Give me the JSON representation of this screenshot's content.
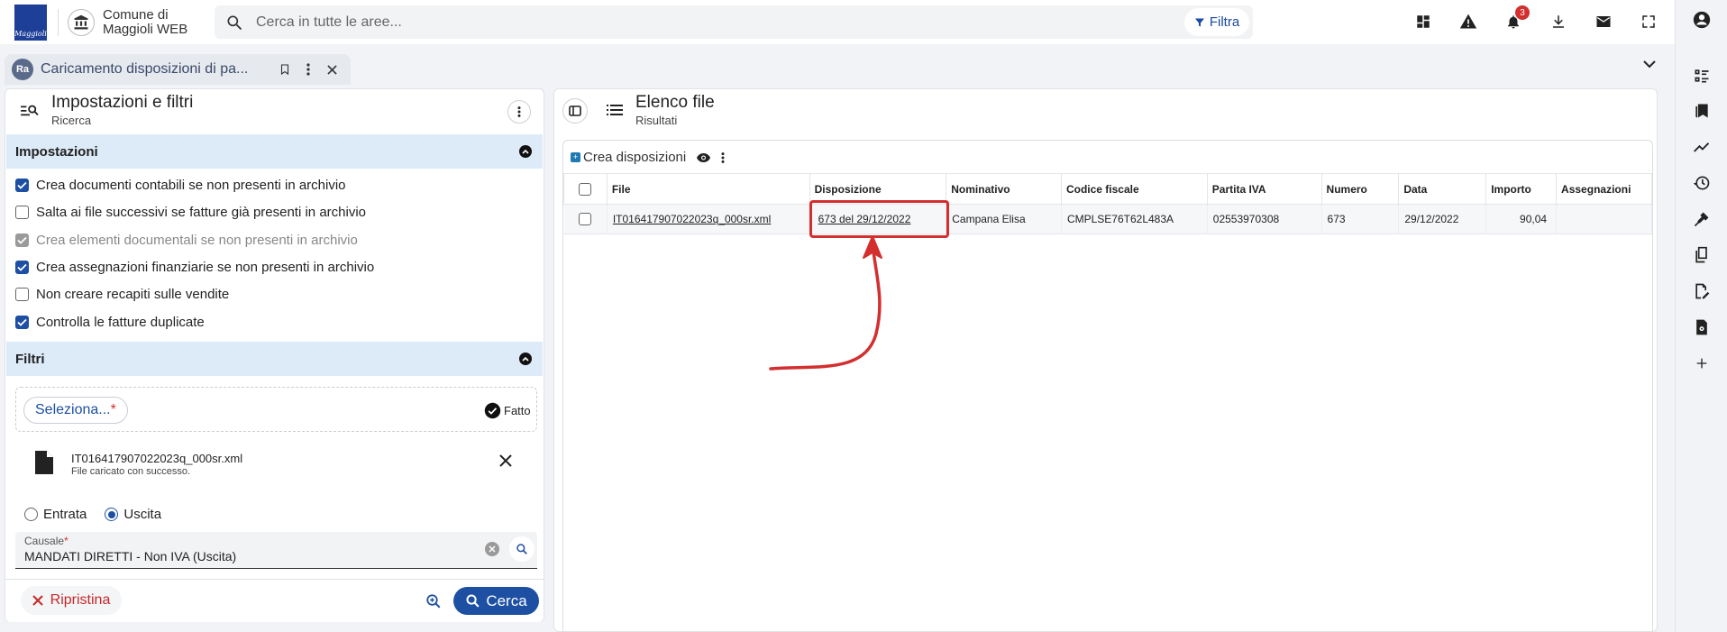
{
  "app": {
    "logo_text": "Maggioli",
    "title": "Comune di Maggioli WEB"
  },
  "search": {
    "placeholder": "Cerca in tutte le aree...",
    "filter_label": "Filtra"
  },
  "topbar_icons": [
    "grid-apps-icon",
    "warning-icon",
    "bell-icon",
    "download-icon",
    "mail-icon",
    "fullscreen-icon",
    "account-icon"
  ],
  "notifications_count": "3",
  "tab": {
    "badge": "Ra",
    "label": "Caricamento disposizioni di pa..."
  },
  "left": {
    "title": "Impostazioni e filtri",
    "subtitle": "Ricerca",
    "settings_header": "Impostazioni",
    "options": [
      {
        "label": "Crea documenti contabili se non presenti in archivio",
        "checked": true
      },
      {
        "label": "Salta ai file successivi se fatture già presenti in archivio",
        "checked": false
      },
      {
        "label": "Crea elementi documentali se non presenti in archivio",
        "checked": true,
        "disabled": true
      },
      {
        "label": "Crea assegnazioni finanziarie se non presenti in archivio",
        "checked": true
      },
      {
        "label": "Non creare recapiti sulle vendite",
        "checked": false
      },
      {
        "label": "Controlla le fatture duplicate",
        "checked": true
      }
    ],
    "filters_header": "Filtri",
    "select_label": "Seleziona...",
    "required_mark": "*",
    "done_label": "Fatto",
    "file": {
      "name": "IT016417907022023q_000sr.xml",
      "status": "File caricato con successo."
    },
    "radio": {
      "entrata": "Entrata",
      "uscita": "Uscita",
      "selected": "Uscita"
    },
    "causale": {
      "label": "Causale",
      "value": "MANDATI DIRETTI - Non IVA (Uscita)"
    },
    "reset_label": "Ripristina",
    "search_label": "Cerca"
  },
  "right": {
    "title": "Elenco file",
    "subtitle": "Risultati",
    "toolbar_label": "Crea disposizioni",
    "columns": [
      "File",
      "Disposizione",
      "Nominativo",
      "Codice fiscale",
      "Partita IVA",
      "Numero",
      "Data",
      "Importo",
      "Assegnazioni"
    ],
    "rows": [
      {
        "file": "IT016417907022023q_000sr.xml",
        "disposizione": "673 del 29/12/2022",
        "nominativo": "Campana Elisa",
        "codice_fiscale": "CMPLSE76T62L483A",
        "partita_iva": "02553970308",
        "numero": "673",
        "data": "29/12/2022",
        "importo": "90,04",
        "assegnazioni": ""
      }
    ]
  },
  "rail_icons": [
    "account-icon",
    "checklist-icon",
    "bookmarks-icon",
    "trending-icon",
    "history-icon",
    "plugin-icon",
    "clipboard-icon",
    "doc-edit-icon",
    "doc-settings-icon",
    "add-icon"
  ],
  "colors": {
    "primary": "#1d4fa3",
    "section_header": "#ddeaf8",
    "highlight": "#d32f2f"
  }
}
